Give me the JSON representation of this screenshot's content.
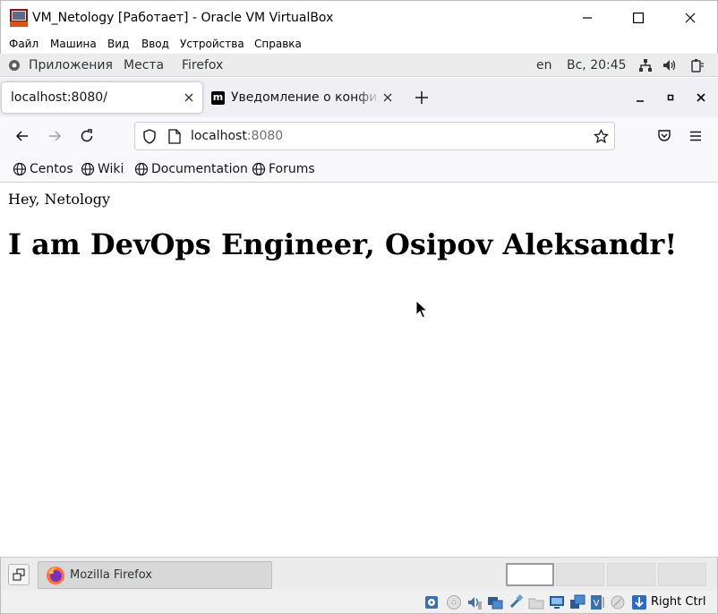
{
  "window": {
    "title": "VM_Netology [Работает] - Oracle VM VirtualBox",
    "icon": "virtualbox-vm-icon"
  },
  "vbox_menu": [
    "Файл",
    "Машина",
    "Вид",
    "Ввод",
    "Устройства",
    "Справка"
  ],
  "gnome_panel": {
    "applications": "Приложения",
    "places": "Места",
    "active_app": "Firefox",
    "keyboard_layout": "en",
    "clock": "Вс, 20:45"
  },
  "firefox": {
    "tabs": [
      {
        "label": "localhost:8080/",
        "active": true
      },
      {
        "label": "Уведомление о конфиденциальности",
        "active": false,
        "favicon_text": "m"
      }
    ],
    "url": {
      "host": "localhost",
      "port": ":8080"
    },
    "bookmarks": [
      "Centos",
      "Wiki",
      "Documentation",
      "Forums"
    ]
  },
  "page": {
    "greeting": "Hey, Netology",
    "heading": "I am DevOps Engineer, Osipov Aleksandr!"
  },
  "taskbar": {
    "task_label": "Mozilla Firefox",
    "workspaces": 4,
    "active_workspace": 1
  },
  "vbox_status": {
    "host_key": "Right Ctrl"
  }
}
